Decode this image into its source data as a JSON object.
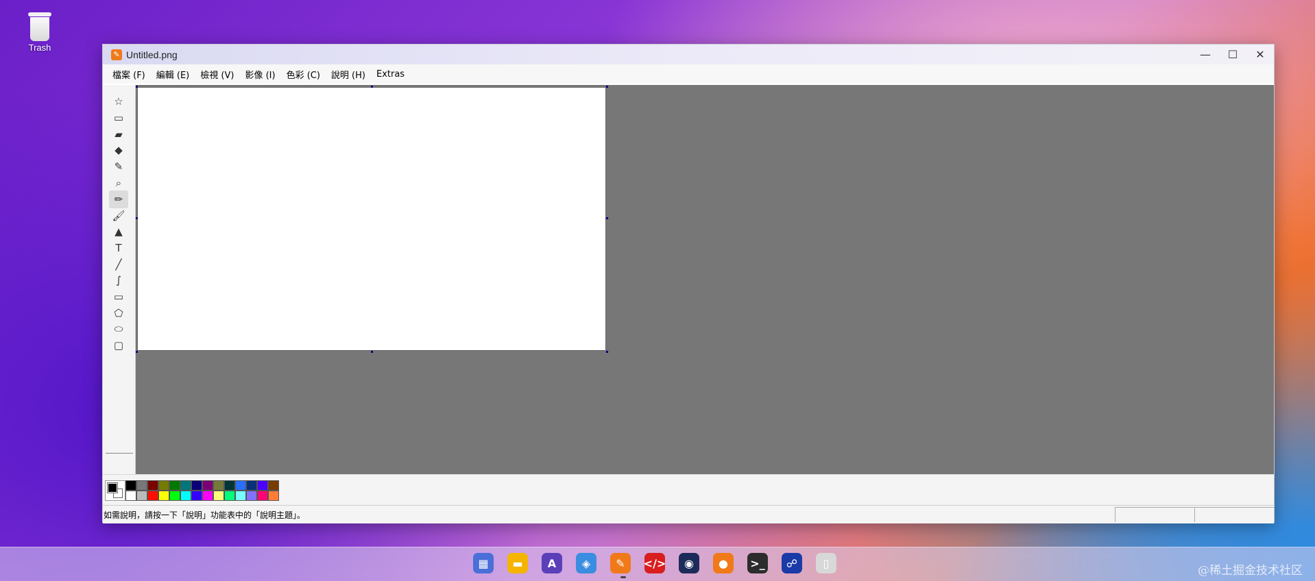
{
  "desktop": {
    "trash_label": "Trash"
  },
  "window": {
    "title": "Untitled.png",
    "controls": {
      "minimize": "—",
      "maximize": "☐",
      "close": "✕"
    }
  },
  "menu": [
    "檔案 (F)",
    "編輯 (E)",
    "檢視 (V)",
    "影像 (I)",
    "色彩 (C)",
    "說明 (H)",
    "Extras"
  ],
  "tools": [
    {
      "name": "free-select-icon",
      "glyph": "☆"
    },
    {
      "name": "rect-select-icon",
      "glyph": "▭"
    },
    {
      "name": "eraser-icon",
      "glyph": "▰"
    },
    {
      "name": "fill-bucket-icon",
      "glyph": "◆"
    },
    {
      "name": "color-picker-icon",
      "glyph": "✎"
    },
    {
      "name": "magnifier-icon",
      "glyph": "⌕"
    },
    {
      "name": "pencil-icon",
      "glyph": "✏"
    },
    {
      "name": "brush-icon",
      "glyph": "🖌"
    },
    {
      "name": "airbrush-icon",
      "glyph": "▲"
    },
    {
      "name": "text-icon",
      "glyph": "T"
    },
    {
      "name": "line-icon",
      "glyph": "╱"
    },
    {
      "name": "curve-icon",
      "glyph": "∫"
    },
    {
      "name": "rectangle-icon",
      "glyph": "▭"
    },
    {
      "name": "polygon-icon",
      "glyph": "⬠"
    },
    {
      "name": "ellipse-icon",
      "glyph": "⬭"
    },
    {
      "name": "rounded-rect-icon",
      "glyph": "▢"
    }
  ],
  "active_tool": "pencil-icon",
  "palette": {
    "foreground": "#000000",
    "background": "#ffffff",
    "row1": [
      "#000000",
      "#787878",
      "#790300",
      "#757a01",
      "#007902",
      "#007778",
      "#0a0078",
      "#7b0077",
      "#767a38",
      "#003637",
      "#286ffe",
      "#083178",
      "#4c00fe",
      "#783b00"
    ],
    "row2": [
      "#ffffff",
      "#bbbbbb",
      "#ff0e00",
      "#faff08",
      "#00ff0b",
      "#00feff",
      "#3400fe",
      "#ff00fe",
      "#fbff7a",
      "#00ff7b",
      "#76feff",
      "#8270fe",
      "#ff0677",
      "#ff7d36"
    ]
  },
  "status": {
    "text": "如需說明，請按一下「說明」功能表中的「說明主題」。"
  },
  "dock": [
    {
      "name": "launcher-icon",
      "glyph": "▦",
      "color": "#4b6fd8"
    },
    {
      "name": "files-icon",
      "glyph": "▬",
      "color": "#f5b400"
    },
    {
      "name": "text-editor-icon",
      "glyph": "A",
      "color": "#5b3fb8"
    },
    {
      "name": "boxes-icon",
      "glyph": "◈",
      "color": "#3a8de0"
    },
    {
      "name": "paint-icon",
      "glyph": "✎",
      "color": "#f07a1a"
    },
    {
      "name": "code-icon",
      "glyph": "</>",
      "color": "#d81e1e"
    },
    {
      "name": "camera-icon",
      "glyph": "◉",
      "color": "#1d2b5a"
    },
    {
      "name": "microphone-icon",
      "glyph": "●",
      "color": "#f07a1a"
    },
    {
      "name": "terminal-icon",
      "glyph": ">_",
      "color": "#2c2c2c"
    },
    {
      "name": "network-icon",
      "glyph": "☍",
      "color": "#1a3aa8"
    },
    {
      "name": "trash-icon",
      "glyph": "▯",
      "color": "#d8d8d8"
    }
  ],
  "watermark": "@稀土掘金技术社区"
}
